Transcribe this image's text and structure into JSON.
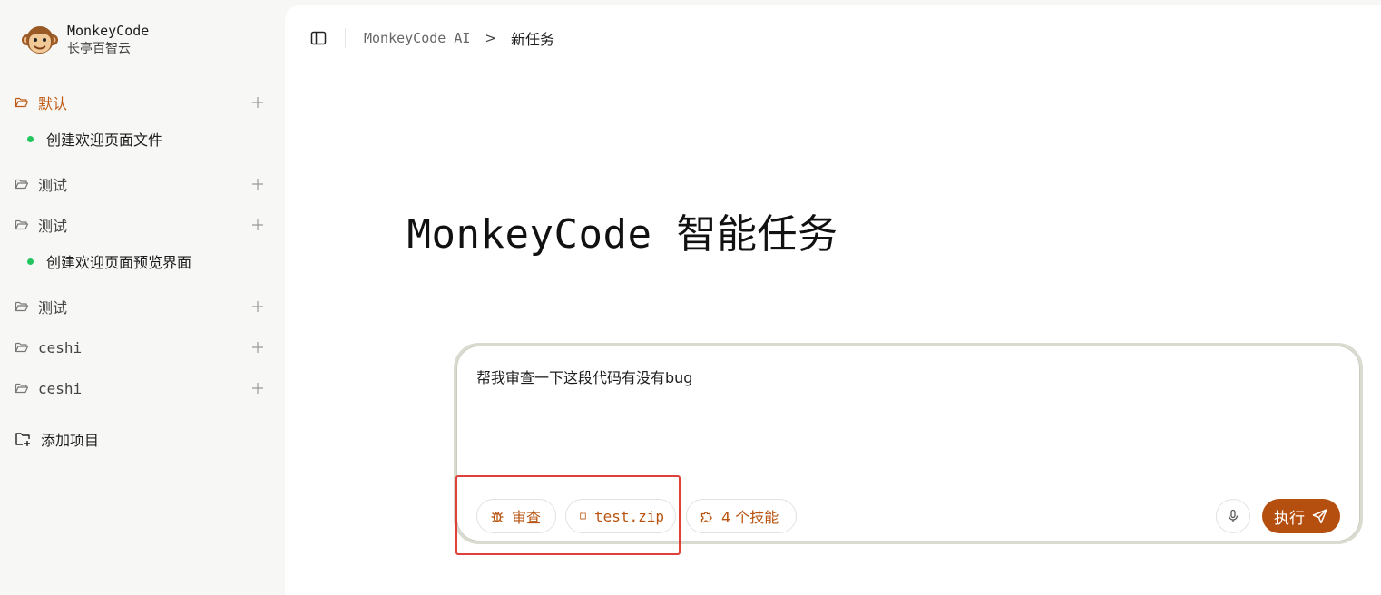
{
  "brand": {
    "name": "MonkeyCode",
    "subtitle": "长亭百智云",
    "logo_icon": "monkey-logo-icon"
  },
  "sidebar": {
    "projects": [
      {
        "label": "默认",
        "active": true,
        "tasks": [
          "创建欢迎页面文件"
        ]
      },
      {
        "label": "测试",
        "active": false,
        "tasks": []
      },
      {
        "label": "测试",
        "active": false,
        "tasks": [
          "创建欢迎页面预览界面"
        ]
      },
      {
        "label": "测试",
        "active": false,
        "tasks": []
      },
      {
        "label": "ceshi",
        "active": false,
        "tasks": []
      },
      {
        "label": "ceshi",
        "active": false,
        "tasks": []
      }
    ],
    "add_project_label": "添加项目"
  },
  "breadcrumb": {
    "root": "MonkeyCode AI",
    "separator": ">",
    "current": "新任务"
  },
  "hero_title": "MonkeyCode 智能任务",
  "composer": {
    "prompt_text": "帮我审查一下这段代码有没有bug",
    "chips": {
      "review": "审查",
      "file": "test.zip",
      "skills": "4 个技能"
    },
    "run_label": "执行"
  },
  "colors": {
    "accent": "#b54f10",
    "active_project": "#c05a12",
    "task_dot": "#22c55e",
    "highlight": "#e0403a"
  }
}
